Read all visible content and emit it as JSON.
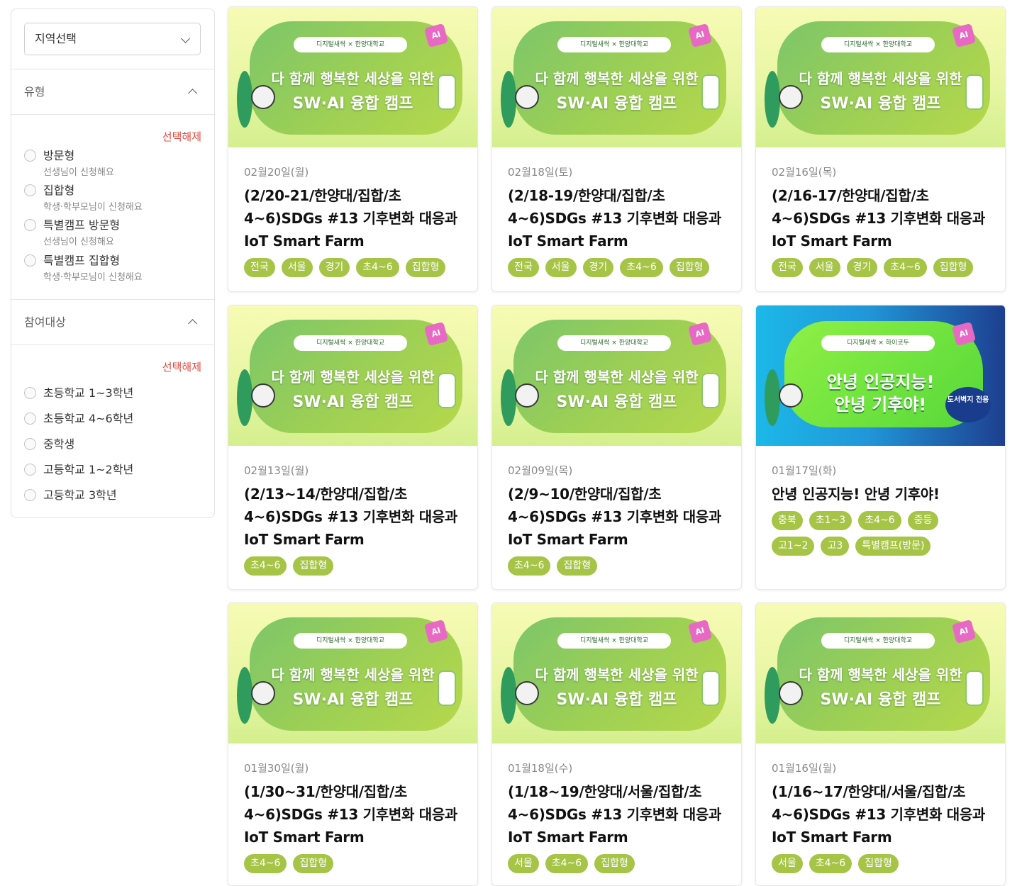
{
  "sidebar": {
    "region_select": "지역선택",
    "type_section": {
      "title": "유형",
      "clear": "선택해제",
      "options": [
        {
          "label": "방문형",
          "sub": "선생님이 신청해요"
        },
        {
          "label": "집합형",
          "sub": "학생·학부모님이 신청해요"
        },
        {
          "label": "특별캠프 방문형",
          "sub": "선생님이 신청해요"
        },
        {
          "label": "특별캠프 집합형",
          "sub": "학생·학부모님이 신청해요"
        }
      ]
    },
    "target_section": {
      "title": "참여대상",
      "clear": "선택해제",
      "options": [
        {
          "label": "초등학교 1~3학년"
        },
        {
          "label": "초등학교 4~6학년"
        },
        {
          "label": "중학생"
        },
        {
          "label": "고등학교 1~2학년"
        },
        {
          "label": "고등학교 3학년"
        }
      ]
    }
  },
  "banner": {
    "partner_text": "디지털새싹 × 한양대학교",
    "headline1": "다 함께 행복한 세상을 위한",
    "headline2": "SW·AI 융합 캠프",
    "ai_badge": "AI",
    "alt_partner_text": "디지털새싹 × 하이코두",
    "alt_headline1": "안녕 인공지능!",
    "alt_headline2": "안녕 기후야!",
    "alt_stamp": "도서벽지 전용"
  },
  "cards": [
    {
      "date": "02월20일(월)",
      "title_lines": [
        "(2/20-21/한양대/집합/초",
        "4~6)SDGs #13 기후변화 대응과",
        "IoT Smart Farm"
      ],
      "tags": [
        "전국",
        "서울",
        "경기",
        "초4~6",
        "집합형"
      ]
    },
    {
      "date": "02월18일(토)",
      "title_lines": [
        "(2/18-19/한양대/집합/초",
        "4~6)SDGs #13 기후변화 대응과",
        "IoT Smart Farm"
      ],
      "tags": [
        "전국",
        "서울",
        "경기",
        "초4~6",
        "집합형"
      ]
    },
    {
      "date": "02월16일(목)",
      "title_lines": [
        "(2/16-17/한양대/집합/초",
        "4~6)SDGs #13 기후변화 대응과",
        "IoT Smart Farm"
      ],
      "tags": [
        "전국",
        "서울",
        "경기",
        "초4~6",
        "집합형"
      ]
    },
    {
      "date": "02월13일(월)",
      "title_lines": [
        "(2/13~14/한양대/집합/초",
        "4~6)SDGs #13 기후변화 대응과",
        "IoT Smart Farm"
      ],
      "tags": [
        "초4~6",
        "집합형"
      ]
    },
    {
      "date": "02월09일(목)",
      "title_lines": [
        "(2/9~10/한양대/집합/초",
        "4~6)SDGs #13 기후변화 대응과",
        "IoT Smart Farm"
      ],
      "tags": [
        "초4~6",
        "집합형"
      ]
    },
    {
      "date": "01월17일(화)",
      "title_lines": [
        "안녕 인공지능! 안녕 기후야!"
      ],
      "tags": [
        "충북",
        "초1~3",
        "초4~6",
        "중등",
        "고1~2",
        "고3",
        "특별캠프(방문)"
      ]
    },
    {
      "date": "01월30일(월)",
      "title_lines": [
        "(1/30~31/한양대/집합/초",
        "4~6)SDGs #13 기후변화 대응과",
        "IoT Smart Farm"
      ],
      "tags": [
        "초4~6",
        "집합형"
      ]
    },
    {
      "date": "01월18일(수)",
      "title_lines": [
        "(1/18~19/한양대/서울/집합/초",
        "4~6)SDGs #13 기후변화 대응과",
        "IoT Smart Farm"
      ],
      "tags": [
        "서울",
        "초4~6",
        "집합형"
      ]
    },
    {
      "date": "01월16일(월)",
      "title_lines": [
        "(1/16~17/한양대/서울/집합/초",
        "4~6)SDGs #13 기후변화 대응과",
        "IoT Smart Farm"
      ],
      "tags": [
        "서울",
        "초4~6",
        "집합형"
      ]
    }
  ]
}
